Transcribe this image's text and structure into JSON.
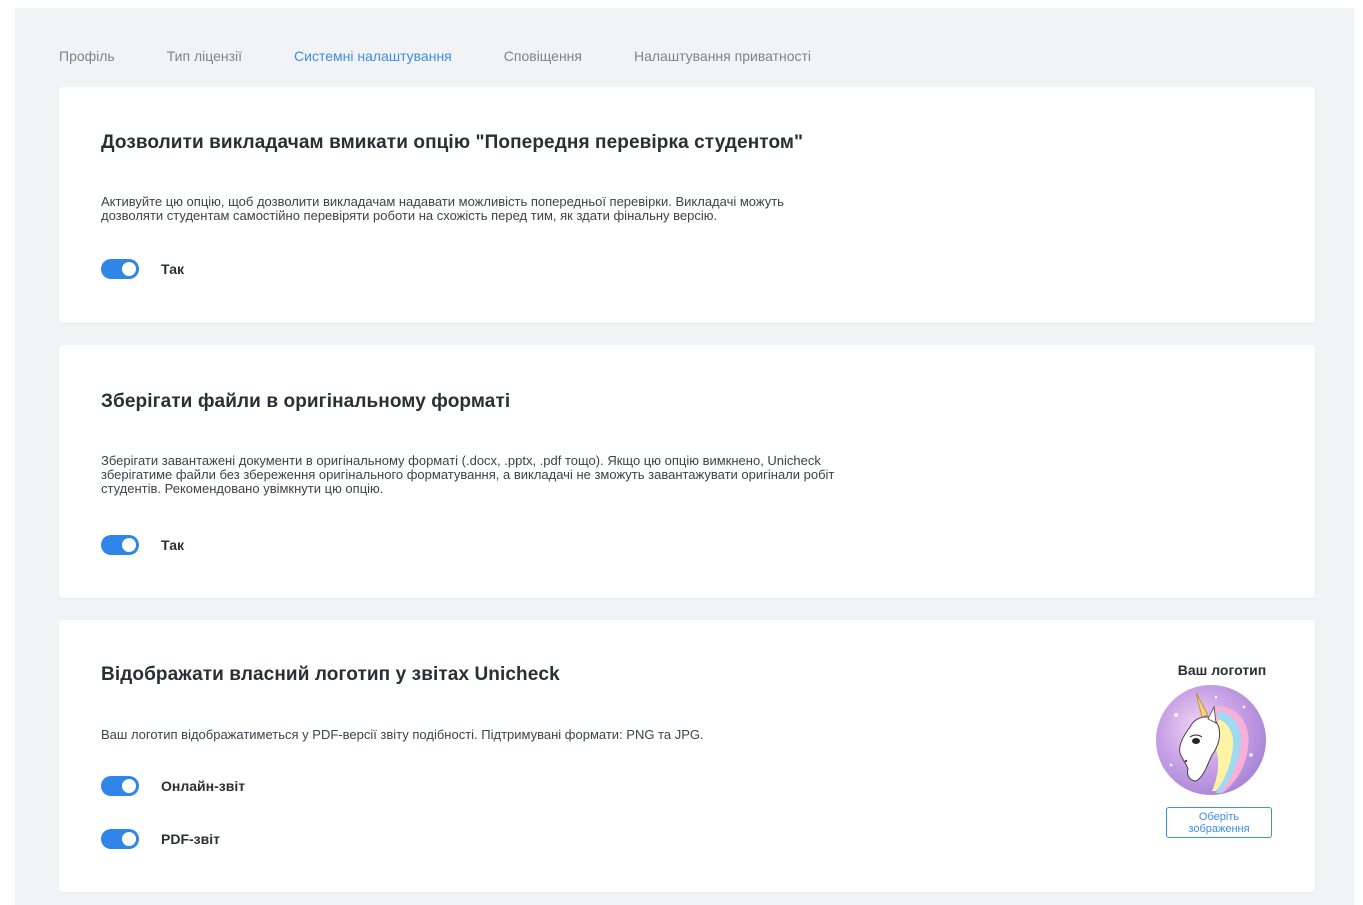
{
  "tabs": [
    {
      "label": "Профіль",
      "active": false
    },
    {
      "label": "Тип ліцензії",
      "active": false
    },
    {
      "label": "Системні налаштування",
      "active": true
    },
    {
      "label": "Сповіщення",
      "active": false
    },
    {
      "label": "Налаштування приватності",
      "active": false
    }
  ],
  "colors": {
    "accent": "#2f86e8",
    "active_tab": "#3d8ee6",
    "page_bg": "#f2f3f5",
    "card_bg": "#ffffff"
  },
  "sections": {
    "pre_check": {
      "title": "Дозволити викладачам вмикати опцію \"Попередня перевірка студентом\"",
      "description_line1": "Активуйте цю опцію, щоб дозволити викладачам надавати можливість попередньої перевірки. Викладачі можуть",
      "description_line2": "дозволяти студентам самостійно перевіряти роботи на схожість перед тим, як здати фінальну версію.",
      "toggle_label": "Так",
      "toggle_on": true
    },
    "original_format": {
      "title": "Зберігати файли в оригінальному форматі",
      "description_line1": "Зберігати завантажені документи в оригінальному форматі (.docx, .pptx, .pdf тощо). Якщо цю опцію вимкнено, Unicheck",
      "description_line2": "зберігатиме файли без збереження оригінального форматування, а викладачі не зможуть завантажувати оригінали робіт",
      "description_line3": "студентів. Рекомендовано увімкнути цю опцію.",
      "toggle_label": "Так",
      "toggle_on": true
    },
    "custom_logo": {
      "title": "Відображати власний логотип у звітах Unicheck",
      "description": "Ваш логотип відображатиметься у PDF-версії звіту подібності. Підтримувані формати: PNG та JPG.",
      "online_report_label": "Онлайн-звіт",
      "online_report_on": true,
      "pdf_report_label": "PDF-звіт",
      "pdf_report_on": true,
      "logo_title": "Ваш логотип",
      "logo_image": "unicorn-logo-image",
      "choose_button_label": "Оберіть зображення"
    }
  }
}
